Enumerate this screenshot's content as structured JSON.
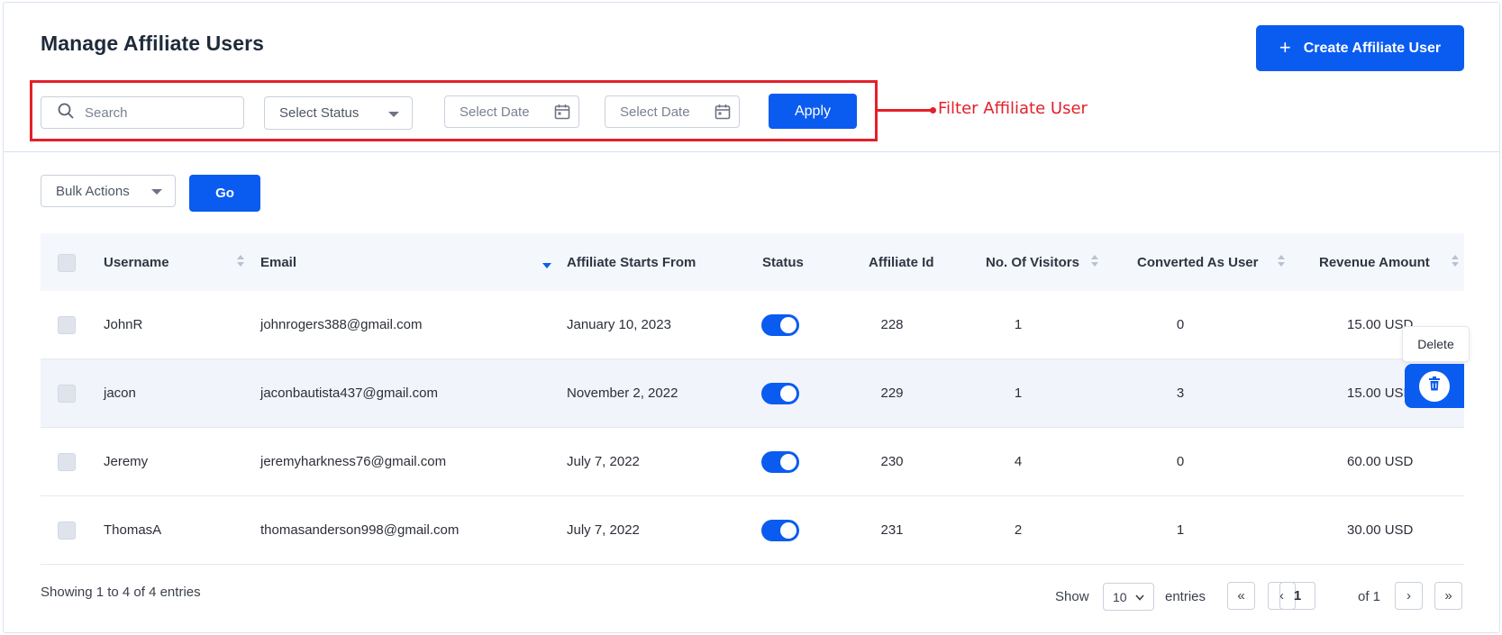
{
  "header": {
    "title": "Manage Affiliate Users",
    "create_button": "Create Affiliate User"
  },
  "annotation": {
    "label": "Filter Affiliate User",
    "color": "#e3202a"
  },
  "filters": {
    "search_placeholder": "Search",
    "status_placeholder": "Select Status",
    "date_from_placeholder": "Select Date",
    "date_to_placeholder": "Select Date",
    "apply_label": "Apply"
  },
  "bulk": {
    "select_label": "Bulk Actions",
    "go_label": "Go"
  },
  "table": {
    "columns": [
      "Username",
      "Email",
      "Affiliate Starts From",
      "Status",
      "Affiliate Id",
      "No. Of Visitors",
      "Converted As User",
      "Revenue Amount"
    ],
    "rows": [
      {
        "username": "JohnR",
        "email": "johnrogers388@gmail.com",
        "start": "January 10, 2023",
        "status_on": true,
        "id": "228",
        "visitors": "1",
        "converted": "0",
        "revenue": "15.00 USD"
      },
      {
        "username": "jacon",
        "email": "jaconbautista437@gmail.com",
        "start": "November 2, 2022",
        "status_on": true,
        "id": "229",
        "visitors": "1",
        "converted": "3",
        "revenue": "15.00 USD"
      },
      {
        "username": "Jeremy",
        "email": "jeremyharkness76@gmail.com",
        "start": "July 7, 2022",
        "status_on": true,
        "id": "230",
        "visitors": "4",
        "converted": "0",
        "revenue": "60.00 USD"
      },
      {
        "username": "ThomasA",
        "email": "thomasanderson998@gmail.com",
        "start": "July 7, 2022",
        "status_on": true,
        "id": "231",
        "visitors": "2",
        "converted": "1",
        "revenue": "30.00 USD"
      }
    ]
  },
  "row_actions": {
    "delete_tooltip": "Delete"
  },
  "footer": {
    "showing_text": "Showing 1 to 4 of 4 entries",
    "show_label": "Show",
    "page_size": "10",
    "entries_label": "entries",
    "first": "«",
    "prev": "‹",
    "current_page": "1",
    "of_label": "of 1",
    "next": "›",
    "last": "»"
  },
  "colors": {
    "accent": "#0a5cf0",
    "alt_row": "#f1f4fa",
    "header_bg": "#f4f7fc"
  }
}
